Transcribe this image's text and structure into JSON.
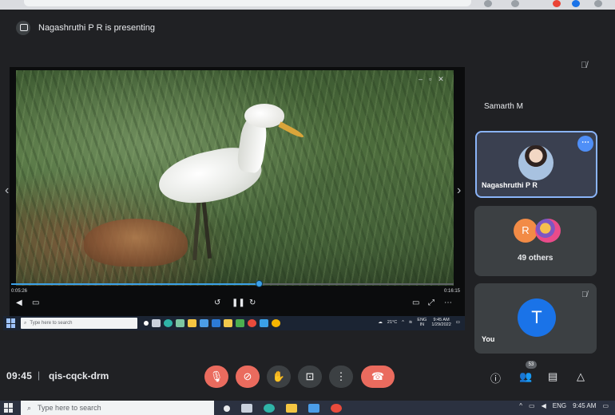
{
  "meeting": {
    "presenting_text": "Nagashruthi P R is presenting",
    "time": "09:45",
    "separator": "|",
    "code": "qis-cqck-drm",
    "participant_count": "53"
  },
  "video": {
    "time_current": "0:05:26",
    "time_total": "0:16:15",
    "progress": 0.56,
    "controls": [
      "volume",
      "captions",
      "back",
      "pause",
      "forward",
      "cast",
      "fullscreen",
      "more"
    ]
  },
  "inner_taskbar": {
    "search_placeholder": "Type here to search",
    "weather": "21°C",
    "lang_top": "ENG",
    "lang_bottom": "IN",
    "clock_time": "9:45 AM",
    "clock_date": "1/29/2022"
  },
  "participants": {
    "top_name": "Samarth M",
    "presenter_name": "Nagashruthi P R",
    "others_avatar_letter": "R",
    "others_label": "49 others",
    "you_letter": "T",
    "you_label": "You"
  },
  "os_taskbar": {
    "search_placeholder": "Type here to search",
    "lang": "ENG",
    "clock_time": "9:45 AM"
  },
  "colors": {
    "accent_blue": "#1a73e8",
    "presenter_border": "#8ab4f8",
    "control_red": "#ea6b5e",
    "progress_blue": "#3ba0e8",
    "panel_bg": "#202124",
    "tile_bg": "#3c4043"
  },
  "icons": {
    "presenting": "present-screen-icon",
    "mic_muted": "mic-off-icon",
    "cam_off": "camera-off-icon",
    "raise_hand": "hand-icon",
    "present_now": "present-icon",
    "more": "more-vert-icon",
    "end_call": "phone-hangup-icon",
    "info": "info-icon",
    "people": "people-icon",
    "chat": "chat-icon",
    "activities": "shapes-icon"
  }
}
